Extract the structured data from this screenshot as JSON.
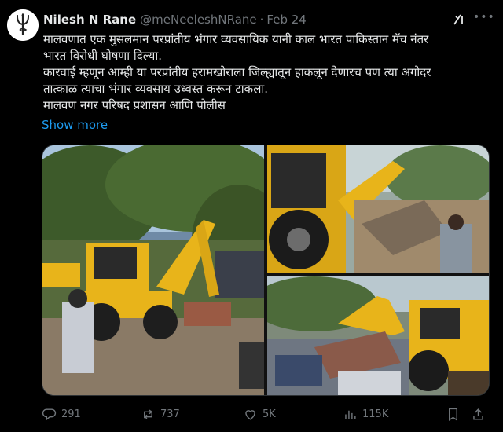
{
  "tweet": {
    "author_name": "Nilesh N Rane",
    "handle": "@meNeeleshNRane",
    "separator": "·",
    "date": "Feb 24",
    "more_icon": "•••",
    "text_lines": [
      "मालवणात एक मुसलमान परप्रांतीय भंगार व्यवसायिक यानी काल भारत पाकिस्तान मॅच नंतर",
      "भारत विरोधी घोषणा दिल्या.",
      "कारवाई म्हणून आम्ही या परप्रांतीय हरामखोराला जिल्ह्यातून हाकलून देणारच पण त्या अगोदर",
      "तात्काळ त्याचा भंगार व्यवसाय उध्वस्त करून टाकला.",
      "मालवण नगर परिषद प्रशासन आणि पोलीस"
    ],
    "show_more": "Show more"
  },
  "actions": {
    "replies": "291",
    "reposts": "737",
    "likes": "5K",
    "views": "115K"
  },
  "icons": {
    "avatar": "trident-avatar-icon",
    "grok": "grok-icon",
    "more": "more-icon",
    "reply": "reply-icon",
    "repost": "repost-icon",
    "like": "heart-icon",
    "views": "views-icon",
    "bookmark": "bookmark-icon",
    "share": "share-icon"
  },
  "colors": {
    "background": "#000000",
    "text": "#e7e9ea",
    "secondary": "#71767b",
    "link": "#1d9bf0",
    "excavator_yellow": "#e8b41a"
  }
}
